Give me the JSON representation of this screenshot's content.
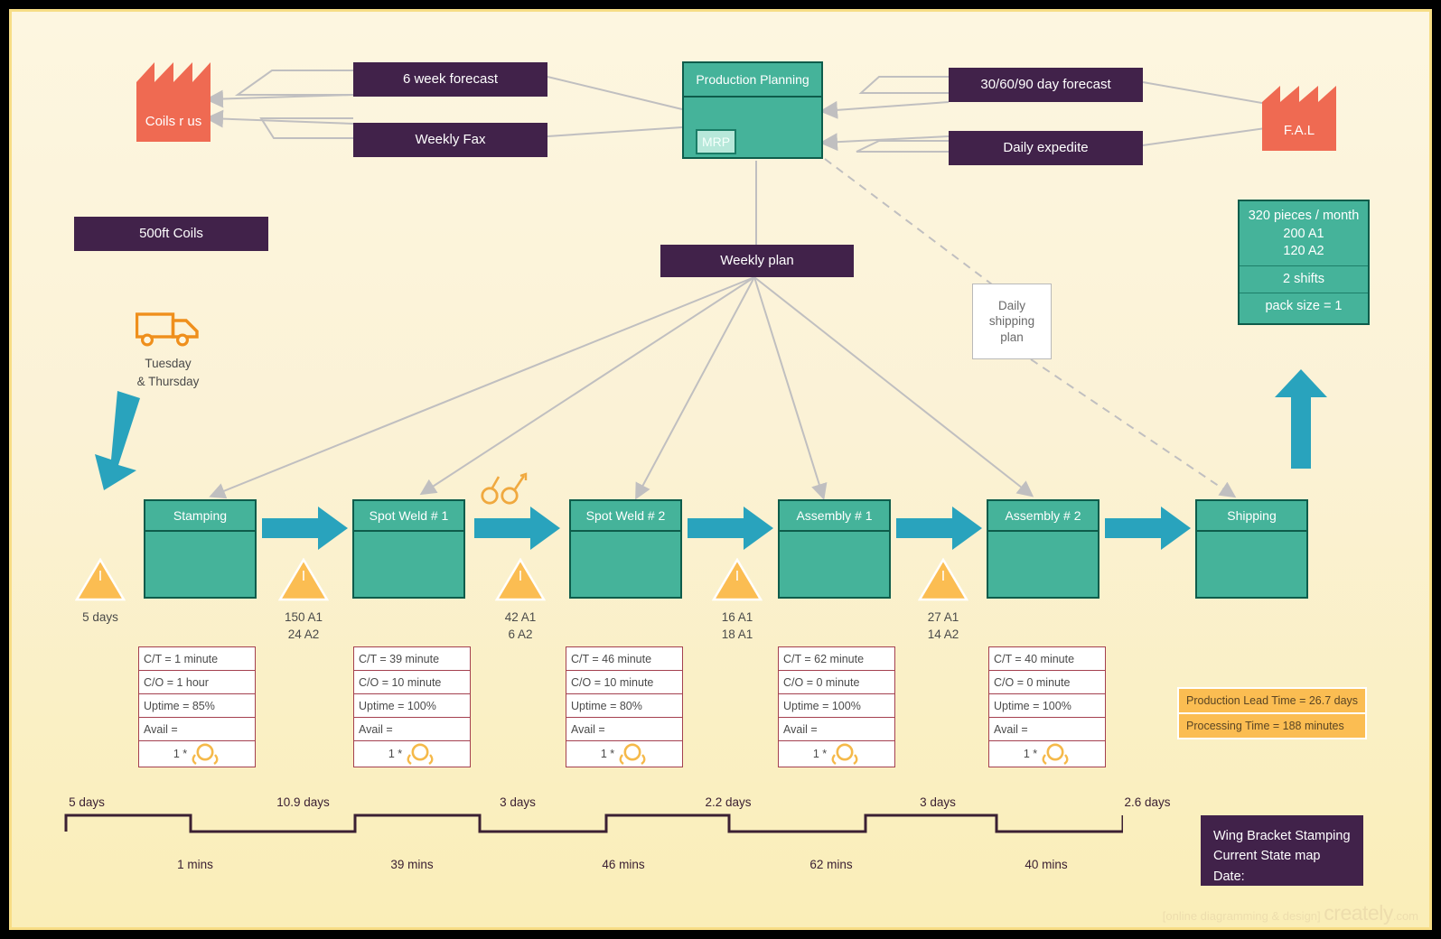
{
  "diagram": {
    "title_block": "Wing Bracket Stamping\nCurrent State map\nDate:",
    "title_line1": "Wing Bracket Stamping",
    "title_line2": "Current State map",
    "title_line3": "Date:",
    "watermark_text": "[online diagramming & design]",
    "watermark_brand": "creately",
    "watermark_tld": ".com",
    "colors": {
      "background": "#fdf6e0",
      "frame_border": "#f7dd85",
      "purple_box": "#41224a",
      "factory_red": "#ef6a52",
      "process_teal": "#45b39a",
      "process_border": "#0e5c4b",
      "mrp_fill": "#b7e8da",
      "arrow_teal": "#29a3bd",
      "inventory_orange": "#fbbd52",
      "databox_border": "#a4404f",
      "info_flow_gray": "#c0bfc0",
      "ladder_stroke": "#3b2033",
      "summary_orange": "#fbbd52"
    }
  },
  "supplier": {
    "name": "Coils r us",
    "icon": "factory-icon"
  },
  "customer": {
    "name": "F.A.L",
    "icon": "factory-icon"
  },
  "supplier_info_boxes": [
    {
      "label": "6 week forecast"
    },
    {
      "label": "Weekly Fax"
    }
  ],
  "customer_info_boxes": [
    {
      "label": "30/60/90 day forecast"
    },
    {
      "label": "Daily expedite"
    }
  ],
  "material_note": {
    "label": "500ft Coils"
  },
  "production_control": {
    "header": "Production Planning",
    "subsystem": "MRP"
  },
  "weekly_plan": {
    "label": "Weekly plan"
  },
  "daily_shipping_plan": {
    "label": "Daily\nshipping\nplan",
    "line1": "Daily",
    "line2": "shipping",
    "line3": "plan"
  },
  "customer_requirements": {
    "cells": [
      "320 pieces / month\n200 A1\n120 A2",
      "2 shifts",
      "pack size = 1"
    ],
    "line_a": "320 pieces / month",
    "line_b": "200 A1",
    "line_c": "120 A2",
    "shifts": "2 shifts",
    "pack_size": "pack size = 1"
  },
  "inbound_shipment": {
    "icon": "truck-icon",
    "frequency_line1": "Tuesday",
    "frequency_line2": "& Thursday"
  },
  "go_see_icon": "glasses-icon",
  "processes": [
    {
      "name": "Stamping",
      "data": {
        "ct": "C/T = 1 minute",
        "co": "C/O =  1 hour",
        "uptime": "Uptime =  85%",
        "avail": "Avail =",
        "operators": "1 *"
      }
    },
    {
      "name": "Spot Weld # 1",
      "data": {
        "ct": "C/T = 39 minute",
        "co": "C/O = 10 minute",
        "uptime": "Uptime = 100%",
        "avail": "Avail =",
        "operators": "1 *"
      }
    },
    {
      "name": "Spot Weld # 2",
      "data": {
        "ct": "C/T = 46 minute",
        "co": "C/O = 10 minute",
        "uptime": "Uptime = 80%",
        "avail": "Avail =",
        "operators": "1 *"
      }
    },
    {
      "name": "Assembly # 1",
      "data": {
        "ct": "C/T = 62 minute",
        "co": "C/O = 0 minute",
        "uptime": "Uptime = 100%",
        "avail": "Avail =",
        "operators": "1 *"
      }
    },
    {
      "name": "Assembly # 2",
      "data": {
        "ct": "C/T = 40 minute",
        "co": "C/O = 0 minute",
        "uptime": "Uptime = 100%",
        "avail": "Avail =",
        "operators": "1 *"
      }
    },
    {
      "name": "Shipping",
      "data": null
    }
  ],
  "inventories": [
    {
      "symbol": "I",
      "line1": "5 days",
      "line2": ""
    },
    {
      "symbol": "I",
      "line1": "150 A1",
      "line2": "24 A2"
    },
    {
      "symbol": "I",
      "line1": "42 A1",
      "line2": "6 A2"
    },
    {
      "symbol": "I",
      "line1": "16 A1",
      "line2": "18 A1"
    },
    {
      "symbol": "I",
      "line1": "27 A1",
      "line2": "14 A2"
    }
  ],
  "timeline": {
    "lead_times": [
      "5 days",
      "10.9 days",
      "3 days",
      "2.2 days",
      "3 days",
      "2.6 days"
    ],
    "process_times": [
      "1 mins",
      "39 mins",
      "46 mins",
      "62 mins",
      "40 mins"
    ]
  },
  "summary": {
    "lead_time": "Production Lead Time = 26.7 days",
    "processing_time": "Processing Time = 188 minutes"
  }
}
